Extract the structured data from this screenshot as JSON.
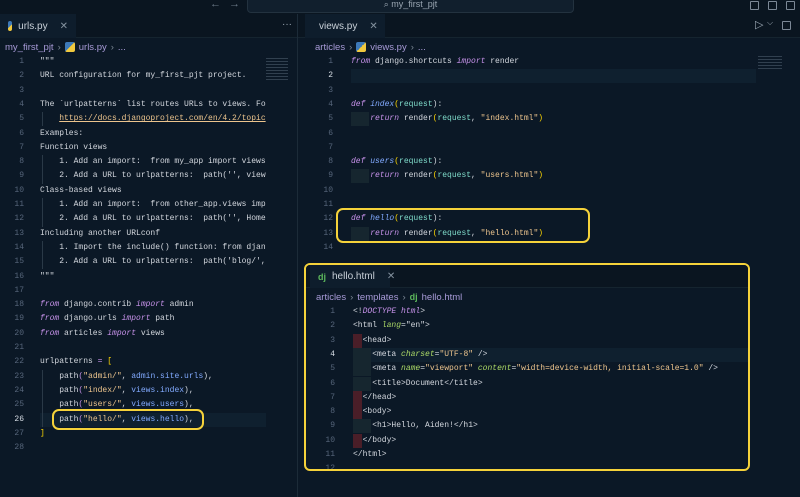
{
  "window": {
    "search_text": "my_first_pjt",
    "back_icon": "arrow-left",
    "forward_icon": "arrow-right"
  },
  "left": {
    "tab": {
      "label": "urls.py",
      "close": "✕"
    },
    "more": "···",
    "breadcrumb": [
      "my_first_pjt",
      "urls.py",
      "..."
    ],
    "current_line": 26,
    "lines": [
      [
        [
          "\"\"\"",
          "cm"
        ]
      ],
      [
        [
          "URL configuration for my_first_pjt project.",
          "cm"
        ]
      ],
      [],
      [
        [
          "The `urlpatterns` list routes URLs to views. Fo",
          "cm"
        ]
      ],
      [
        [
          "    ",
          "cm"
        ],
        [
          "https://docs.djangoproject.com/en/4.2/topic",
          "url"
        ]
      ],
      [
        [
          "Examples:",
          "cm"
        ]
      ],
      [
        [
          "Function views",
          "cm"
        ]
      ],
      [
        [
          "    1. Add an import:  from my_app import views",
          "cm"
        ]
      ],
      [
        [
          "    2. Add a URL to urlpatterns:  path('', view",
          "cm"
        ]
      ],
      [
        [
          "Class-based views",
          "cm"
        ]
      ],
      [
        [
          "    1. Add an import:  from other_app.views imp",
          "cm"
        ]
      ],
      [
        [
          "    2. Add a URL to urlpatterns:  path('', Home",
          "cm"
        ]
      ],
      [
        [
          "Including another URLconf",
          "cm"
        ]
      ],
      [
        [
          "    1. Import the include() function: from djan",
          "cm"
        ]
      ],
      [
        [
          "    2. Add a URL to urlpatterns:  path('blog/',",
          "cm"
        ]
      ],
      [
        [
          "\"\"\"",
          "cm"
        ]
      ],
      [],
      [
        [
          "from",
          "kw"
        ],
        [
          " django.contrib ",
          ""
        ],
        [
          "import",
          "kw"
        ],
        [
          " admin",
          ""
        ]
      ],
      [
        [
          "from",
          "kw"
        ],
        [
          " django.urls ",
          ""
        ],
        [
          "import",
          "kw"
        ],
        [
          " path",
          ""
        ]
      ],
      [
        [
          "from",
          "kw"
        ],
        [
          " articles ",
          ""
        ],
        [
          "import",
          "kw"
        ],
        [
          " views",
          ""
        ]
      ],
      [],
      [
        [
          "urlpatterns ",
          ""
        ],
        [
          "=",
          "op"
        ],
        [
          " ",
          ""
        ],
        [
          "[",
          "par"
        ]
      ],
      [
        [
          "    path",
          ""
        ],
        [
          "(",
          "op"
        ],
        [
          "\"admin/\"",
          "str"
        ],
        [
          ", ",
          ""
        ],
        [
          "admin.site.urls",
          "mem"
        ],
        [
          "),",
          ""
        ]
      ],
      [
        [
          "    path",
          ""
        ],
        [
          "(",
          "op"
        ],
        [
          "\"index/\"",
          "str"
        ],
        [
          ", ",
          ""
        ],
        [
          "views.index",
          "mem"
        ],
        [
          "),",
          ""
        ]
      ],
      [
        [
          "    path",
          ""
        ],
        [
          "(",
          "op"
        ],
        [
          "\"users/\"",
          "str"
        ],
        [
          ", ",
          ""
        ],
        [
          "views.users",
          "mem"
        ],
        [
          "),",
          ""
        ]
      ],
      [
        [
          "    path",
          ""
        ],
        [
          "(",
          "op"
        ],
        [
          "\"hello/\"",
          "str"
        ],
        [
          ", ",
          ""
        ],
        [
          "views.hello",
          "mem"
        ],
        [
          "),",
          ""
        ]
      ],
      [
        [
          "]",
          "par"
        ]
      ],
      []
    ]
  },
  "right": {
    "tab": {
      "label": "views.py",
      "close": "✕"
    },
    "run_icon": "▷",
    "run_menu": "⌵",
    "split_icon": "split-editor",
    "breadcrumb": [
      "articles",
      "views.py",
      "..."
    ],
    "current_line": 2,
    "lines": [
      [
        [
          "from",
          "kw"
        ],
        [
          " django.shortcuts ",
          ""
        ],
        [
          "import",
          "kw"
        ],
        [
          " render",
          ""
        ]
      ],
      [],
      [],
      [
        [
          "def ",
          "kw"
        ],
        [
          "index",
          "fn"
        ],
        [
          "(",
          "par"
        ],
        [
          "request",
          "prm"
        ],
        [
          "):",
          ""
        ]
      ],
      [
        [
          "    ",
          ""
        ],
        [
          "return",
          "kw"
        ],
        [
          " render",
          ""
        ],
        [
          "(",
          "par"
        ],
        [
          "request",
          "prm"
        ],
        [
          ", ",
          ""
        ],
        [
          "\"index.html\"",
          "str"
        ],
        [
          ")",
          "par"
        ]
      ],
      [],
      [],
      [
        [
          "def ",
          "kw"
        ],
        [
          "users",
          "fn"
        ],
        [
          "(",
          "par"
        ],
        [
          "request",
          "prm"
        ],
        [
          "):",
          ""
        ]
      ],
      [
        [
          "    ",
          ""
        ],
        [
          "return",
          "kw"
        ],
        [
          " render",
          ""
        ],
        [
          "(",
          "par"
        ],
        [
          "request",
          "prm"
        ],
        [
          ", ",
          ""
        ],
        [
          "\"users.html\"",
          "str"
        ],
        [
          ")",
          "par"
        ]
      ],
      [],
      [],
      [
        [
          "def ",
          "kw"
        ],
        [
          "hello",
          "fn"
        ],
        [
          "(",
          "par"
        ],
        [
          "request",
          "prm"
        ],
        [
          "):",
          ""
        ]
      ],
      [
        [
          "    ",
          ""
        ],
        [
          "return",
          "kw"
        ],
        [
          " render",
          ""
        ],
        [
          "(",
          "par"
        ],
        [
          "request",
          "prm"
        ],
        [
          ", ",
          ""
        ],
        [
          "\"hello.html\"",
          "str"
        ],
        [
          ")",
          "par"
        ]
      ],
      []
    ]
  },
  "html": {
    "tab": {
      "label": "hello.html",
      "close": "✕",
      "icon": "dj"
    },
    "breadcrumb": [
      "articles",
      "templates",
      "hello.html"
    ],
    "current_line": 4,
    "lines": [
      [
        [
          "<!",
          "tag"
        ],
        [
          "DOCTYPE html",
          "doct"
        ],
        [
          ">",
          "tag"
        ]
      ],
      [
        [
          "<html ",
          "tag"
        ],
        [
          "lang",
          "attr"
        ],
        [
          "=",
          "tag"
        ],
        [
          "\"en\"",
          "cm"
        ],
        [
          ">",
          "tag"
        ]
      ],
      [
        [
          "  <head>",
          "tag"
        ]
      ],
      [
        [
          "    <meta ",
          "tag"
        ],
        [
          "charset",
          "attr"
        ],
        [
          "=",
          "tag"
        ],
        [
          "\"UTF-8\"",
          "str"
        ],
        [
          " />",
          "tag"
        ]
      ],
      [
        [
          "    <meta ",
          "tag"
        ],
        [
          "name",
          "attr"
        ],
        [
          "=",
          "tag"
        ],
        [
          "\"viewport\"",
          "str"
        ],
        [
          " ",
          ""
        ],
        [
          "content",
          "attr"
        ],
        [
          "=",
          "tag"
        ],
        [
          "\"width=device-width, initial-scale=1.0\"",
          "str"
        ],
        [
          " />",
          "tag"
        ]
      ],
      [
        [
          "    <title>Document</title>",
          "tag"
        ]
      ],
      [
        [
          "  </head>",
          "tag"
        ]
      ],
      [
        [
          "  <body>",
          "tag"
        ]
      ],
      [
        [
          "    <h1>Hello, Aiden!</h1>",
          "tag"
        ]
      ],
      [
        [
          "  </body>",
          "tag"
        ]
      ],
      [
        [
          "</html>",
          "tag"
        ]
      ],
      []
    ]
  }
}
